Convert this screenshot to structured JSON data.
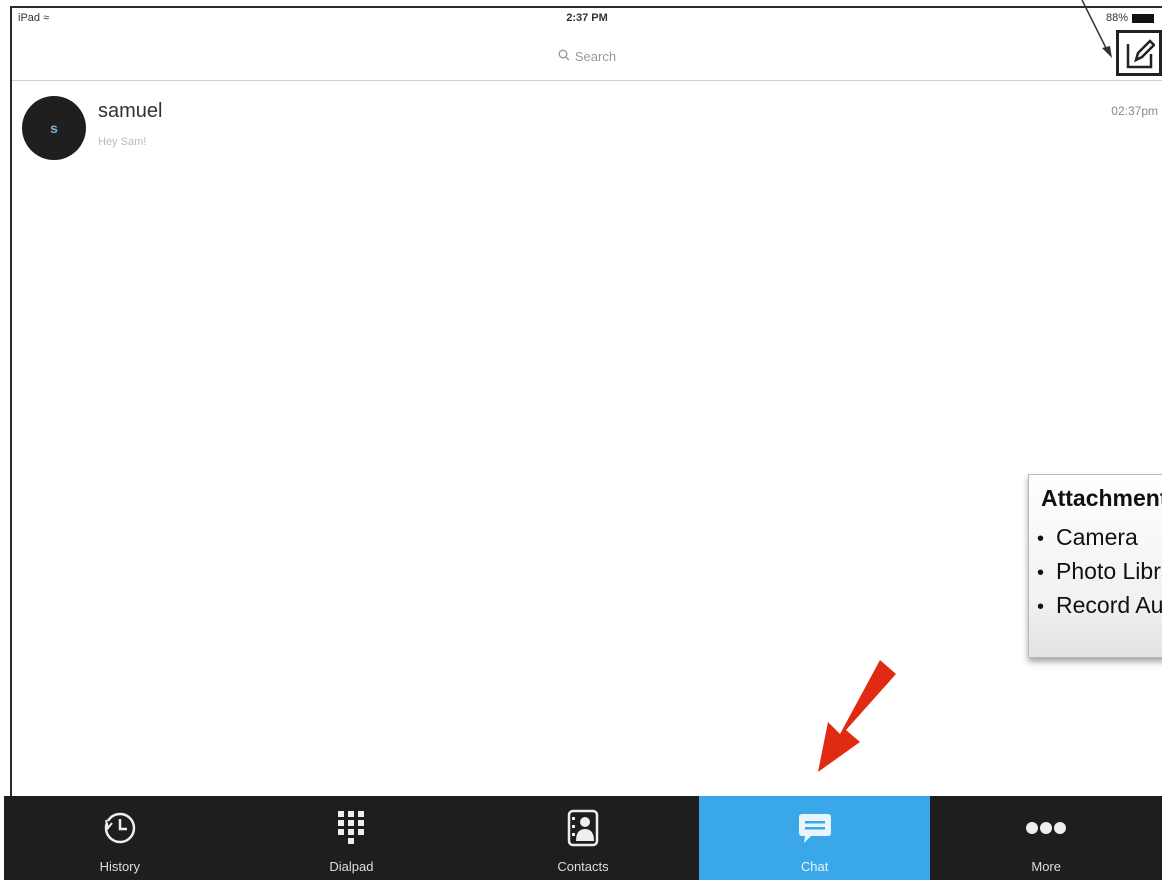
{
  "status_bar": {
    "device": "iPad",
    "wifi_icon": "wifi-icon",
    "time": "2:37 PM",
    "battery_percent": "88%"
  },
  "search": {
    "label": "Search"
  },
  "compose_icon": "compose-icon",
  "conversations": [
    {
      "avatar_initial": "s",
      "name": "samuel",
      "preview": "Hey Sam!",
      "time": "02:37pm"
    }
  ],
  "callout": {
    "title": "Attachments",
    "items": [
      "Camera",
      "Photo Library",
      "Record Audio"
    ]
  },
  "tabs": [
    {
      "label": "History",
      "icon": "history-clock-icon"
    },
    {
      "label": "Dialpad",
      "icon": "dialpad-icon"
    },
    {
      "label": "Contacts",
      "icon": "contacts-icon"
    },
    {
      "label": "Chat",
      "icon": "chat-bubble-icon",
      "active": true
    },
    {
      "label": "More",
      "icon": "more-dots-icon"
    }
  ],
  "colors": {
    "active_tab": "#3aa8e8",
    "tabbar_bg": "#1e1e1e",
    "annotation_arrow": "#e02a12"
  }
}
